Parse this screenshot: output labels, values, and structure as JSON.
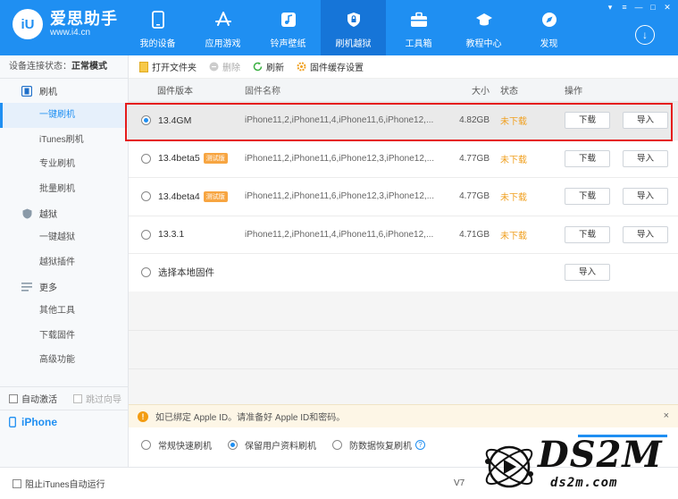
{
  "app": {
    "name": "爱思助手",
    "url": "www.i4.cn",
    "logo_text": "iU"
  },
  "nav": [
    {
      "label": "我的设备",
      "icon": "phone-icon"
    },
    {
      "label": "应用游戏",
      "icon": "appstore-icon"
    },
    {
      "label": "铃声壁纸",
      "icon": "music-icon"
    },
    {
      "label": "刷机越狱",
      "icon": "shield-icon",
      "active": true
    },
    {
      "label": "工具箱",
      "icon": "toolbox-icon"
    },
    {
      "label": "教程中心",
      "icon": "graduation-cap-icon"
    },
    {
      "label": "发现",
      "icon": "compass-icon"
    }
  ],
  "sidebar": {
    "status_label": "设备连接状态：",
    "status_value": "正常模式",
    "sections": {
      "flash": "刷机",
      "jailbreak": "越狱",
      "more": "更多"
    },
    "items": {
      "one_click_flash": "一键刷机",
      "itunes_flash": "iTunes刷机",
      "pro_flash": "专业刷机",
      "batch_flash": "批量刷机",
      "one_click_jb": "一键越狱",
      "jb_plugins": "越狱插件",
      "other_tools": "其他工具",
      "download_fw": "下载固件",
      "advanced": "高级功能"
    },
    "auto_activate": "自动激活",
    "skip_guide": "跳过向导",
    "device": "iPhone"
  },
  "toolbar": {
    "open_folder": "打开文件夹",
    "delete": "删除",
    "refresh": "刷新",
    "cache_settings": "固件缓存设置"
  },
  "table": {
    "headers": {
      "version": "固件版本",
      "name": "固件名称",
      "size": "大小",
      "state": "状态",
      "actions": "操作"
    },
    "rows": [
      {
        "version": "13.4GM",
        "badge": "",
        "name": "iPhone11,2,iPhone11,4,iPhone11,6,iPhone12,...",
        "size": "4.82GB",
        "state": "未下载",
        "download": "下载",
        "import": "导入"
      },
      {
        "version": "13.4beta5",
        "badge": "测试版",
        "name": "iPhone11,2,iPhone11,6,iPhone12,3,iPhone12,...",
        "size": "4.77GB",
        "state": "未下载",
        "download": "下载",
        "import": "导入"
      },
      {
        "version": "13.4beta4",
        "badge": "测试版",
        "name": "iPhone11,2,iPhone11,6,iPhone12,3,iPhone12,...",
        "size": "4.77GB",
        "state": "未下载",
        "download": "下载",
        "import": "导入"
      },
      {
        "version": "13.3.1",
        "badge": "",
        "name": "iPhone11,2,iPhone11,4,iPhone11,6,iPhone12,...",
        "size": "4.71GB",
        "state": "未下载",
        "download": "下载",
        "import": "导入"
      }
    ],
    "local": {
      "label": "选择本地固件",
      "import": "导入"
    }
  },
  "notice": {
    "text": "如已绑定 Apple ID。请准备好 Apple ID和密码。",
    "close": "×"
  },
  "modes": {
    "quick": "常规快速刷机",
    "keep": "保留用户资料刷机",
    "anti_recovery": "防数据恢复刷机",
    "help": "?"
  },
  "statusbar": {
    "block_itunes": "阻止iTunes自动运行",
    "version": "V7"
  },
  "watermark": {
    "main": "DS2M",
    "sub": "ds2m.com"
  },
  "colors": {
    "brand": "#1f8ff2",
    "highlight": "#e51c1c",
    "pending": "#f0a020",
    "badge": "#f7a541"
  }
}
